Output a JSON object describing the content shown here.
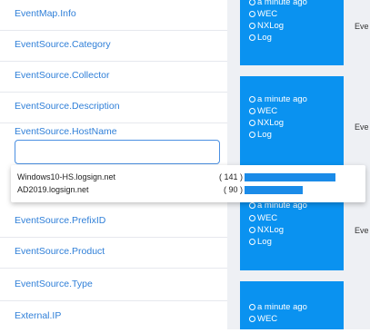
{
  "fields": [
    "EventMap.Info",
    "EventSource.Category",
    "EventSource.Collector",
    "EventSource.Description",
    "EventSource.HostName",
    "EventSource.PrefixID",
    "EventSource.Product",
    "EventSource.Type",
    "External.IP"
  ],
  "search": {
    "value": ""
  },
  "dropdown": [
    {
      "name": "Windows10-HS.logsign.net",
      "count": "( 141 )",
      "share": 0.78
    },
    {
      "name": "AD2019.logsign.net",
      "count": "( 90 )",
      "share": 0.5
    }
  ],
  "cards": [
    {
      "lines": [
        "a minute ago",
        "WEC",
        "NXLog",
        "Log"
      ]
    },
    {
      "lines": [
        "a minute ago",
        "WEC",
        "NXLog",
        "Log"
      ]
    },
    {
      "lines": [
        "a minute ago",
        "WEC",
        "NXLog",
        "Log"
      ]
    },
    {
      "lines": [
        "a minute ago",
        "WEC"
      ]
    }
  ],
  "ev_labels": [
    "Eve",
    "Eve",
    "Eve"
  ],
  "colors": {
    "accent": "#0a92f0",
    "link": "#2f7fd8",
    "bar": "#1a8be8"
  }
}
